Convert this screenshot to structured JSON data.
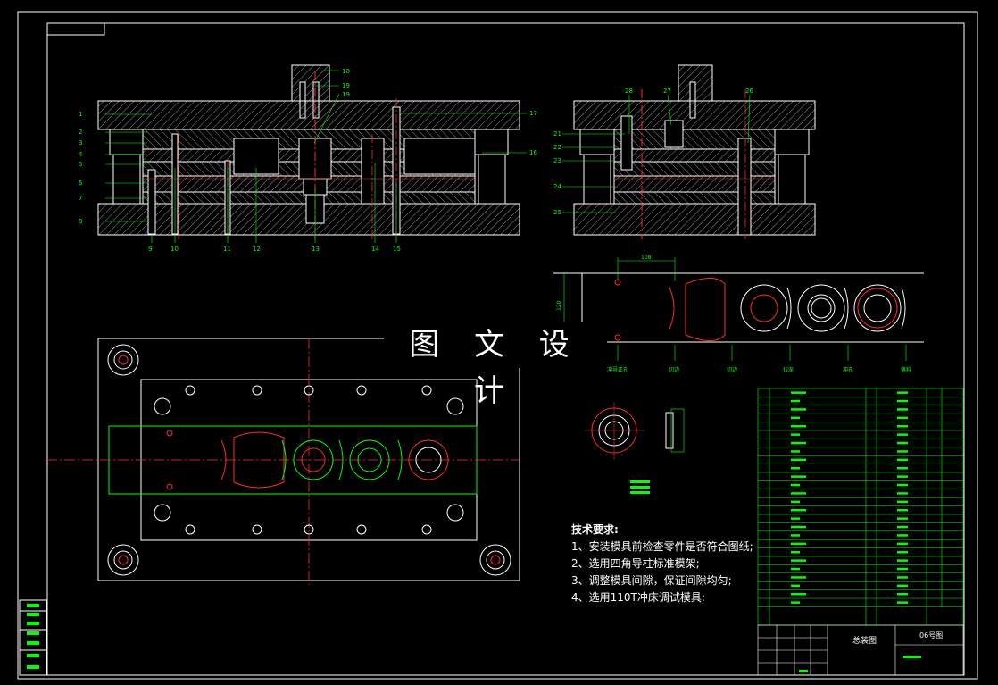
{
  "watermark": "图 文 设 计",
  "dimensions": {
    "pitch": "108",
    "strip_width": "120"
  },
  "technical_requirements": {
    "title": "技术要求:",
    "items": [
      "1、安装模具前检查零件是否符合图纸;",
      "2、选用四角导柱标准模架;",
      "3、调整模具间隙，保证间隙均匀;",
      "4、选用110T冲床调试模具;"
    ]
  },
  "strip_station_labels": [
    "冲导正孔",
    "切边",
    "切边",
    "拉深",
    "冲孔",
    "落料"
  ],
  "part_callouts_left": [
    "1",
    "2",
    "3",
    "4",
    "5",
    "6",
    "7",
    "8"
  ],
  "part_callouts_bottom": [
    "9",
    "10",
    "11",
    "12",
    "13",
    "14",
    "15"
  ],
  "part_callouts_right": [
    "16",
    "17"
  ],
  "part_callouts_top": [
    "18",
    "19",
    "19"
  ],
  "side_callouts_left": [
    "21",
    "22",
    "23",
    "24",
    "25"
  ],
  "side_callouts_top": [
    "28",
    "27",
    "26"
  ],
  "title_block": {
    "drawing_name": "总装图",
    "drawing_no": "06号图"
  },
  "colors": {
    "section": "#ffffff",
    "leader": "#00ff00",
    "centerline": "#ff2a2a",
    "part_outline": "#00ff00",
    "table": "#00ff00",
    "background": "#000000"
  }
}
